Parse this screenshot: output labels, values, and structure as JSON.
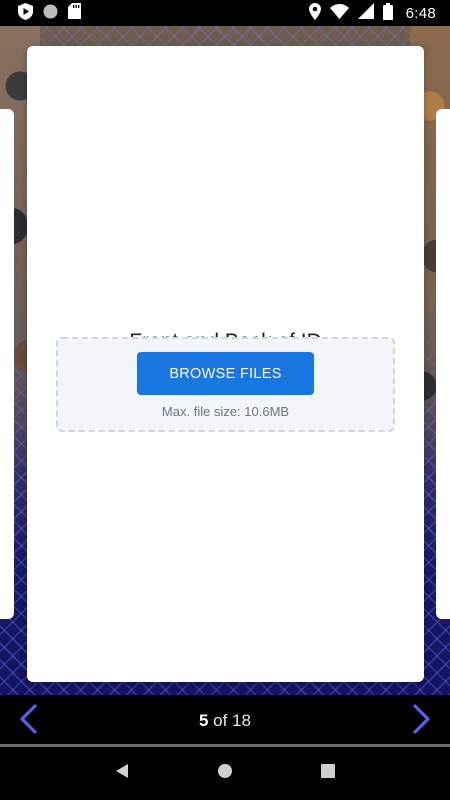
{
  "status_bar": {
    "time": "6:48",
    "left_icons": [
      "play-protect-icon",
      "circle-notification-icon",
      "sd-card-icon"
    ],
    "right_icons": [
      "location-icon",
      "wifi-icon",
      "signal-icon",
      "battery-icon"
    ]
  },
  "card": {
    "title": "Front and Back of ID",
    "browse_button_label": "BROWSE FILES",
    "file_size_note": "Max. file size: 10.6MB"
  },
  "pager": {
    "current": "5",
    "separator": " of ",
    "total": "18"
  },
  "colors": {
    "accent": "#1877e0",
    "arrow": "#5b5ff0",
    "dropzone_bg": "#f2f5f9"
  }
}
